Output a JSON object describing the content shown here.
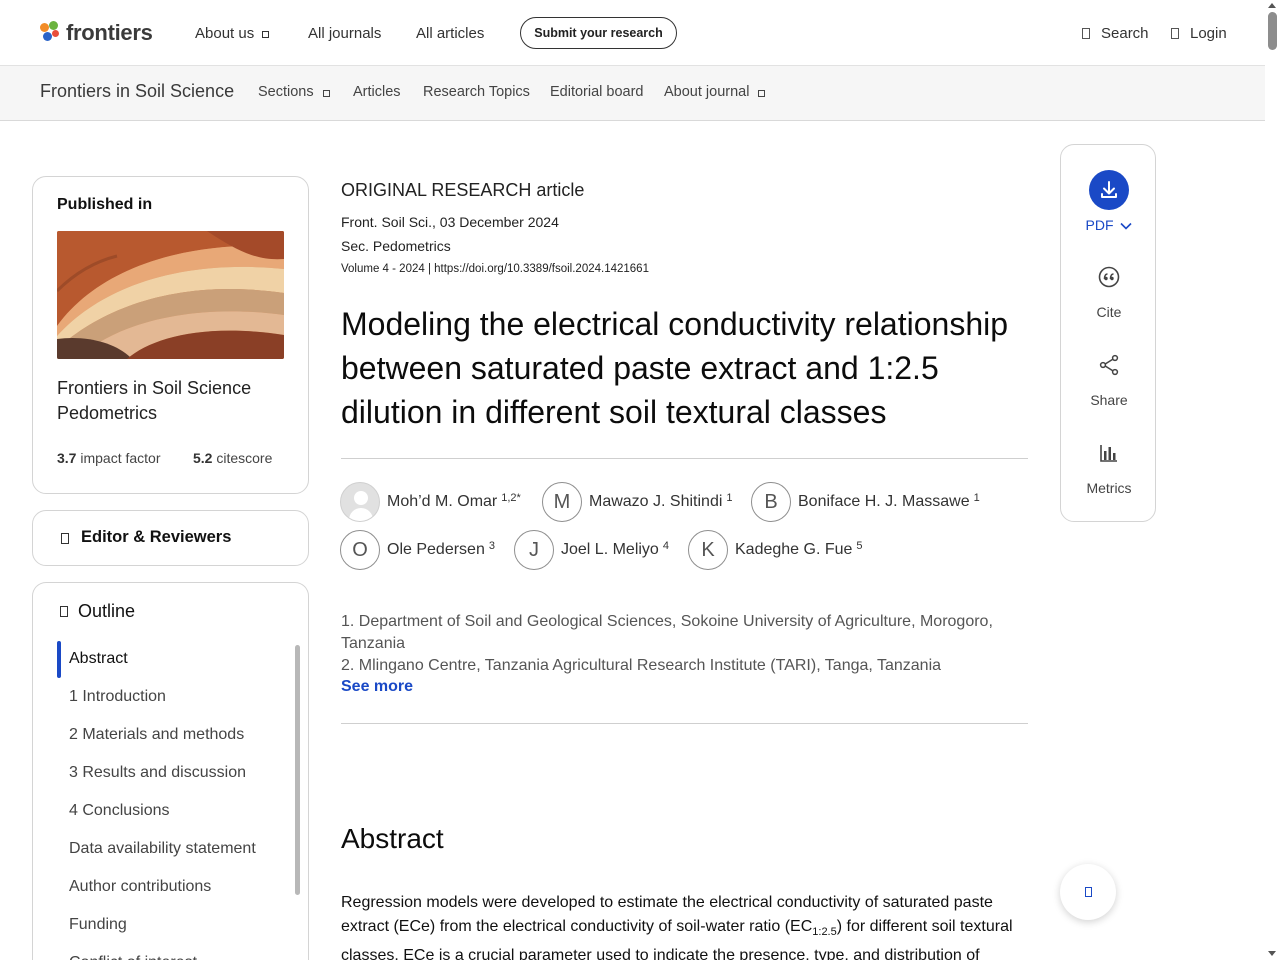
{
  "header": {
    "logo_text": "frontiers",
    "nav": [
      {
        "label": "About us",
        "has_dropdown": true
      },
      {
        "label": "All journals",
        "has_dropdown": false
      },
      {
        "label": "All articles",
        "has_dropdown": false
      }
    ],
    "submit_label": "Submit your research",
    "search_label": "Search",
    "login_label": "Login"
  },
  "journal_bar": {
    "title": "Frontiers in Soil Science",
    "nav": [
      {
        "label": "Sections",
        "has_dropdown": true
      },
      {
        "label": "Articles",
        "has_dropdown": false
      },
      {
        "label": "Research Topics",
        "has_dropdown": false
      },
      {
        "label": "Editorial board",
        "has_dropdown": false
      },
      {
        "label": "About journal",
        "has_dropdown": true
      }
    ]
  },
  "sidebar": {
    "published_in": {
      "heading": "Published in",
      "journal": "Frontiers in Soil Science",
      "section": "Pedometrics",
      "impact_factor_value": "3.7",
      "impact_factor_label": "impact factor",
      "citescore_value": "5.2",
      "citescore_label": "citescore"
    },
    "editor_label": "Editor & Reviewers",
    "outline": {
      "heading": "Outline",
      "items": [
        "Abstract",
        "1 Introduction",
        "2 Materials and methods",
        "3 Results and discussion",
        "4 Conclusions",
        "Data availability statement",
        "Author contributions",
        "Funding",
        "Conflict of interest"
      ],
      "active_index": 0
    }
  },
  "article": {
    "type": "ORIGINAL RESEARCH article",
    "citation": "Front. Soil Sci., 03 December 2024",
    "section": "Sec. Pedometrics",
    "volume": "Volume 4 - 2024 | ",
    "doi": "https://doi.org/10.3389/fsoil.2024.1421661",
    "title": "Modeling the electrical conductivity relationship between saturated paste extract and 1:2.5 dilution in different soil textural classes",
    "authors": [
      {
        "name": "Moh’d M. Omar",
        "aff": "1,2*",
        "initial": "",
        "photo": true
      },
      {
        "name": "Mawazo J. Shitindi",
        "aff": "1",
        "initial": "M"
      },
      {
        "name": "Boniface H. J. Massawe",
        "aff": "1",
        "initial": "B"
      },
      {
        "name": "Ole Pedersen",
        "aff": "3",
        "initial": "O"
      },
      {
        "name": "Joel L. Meliyo",
        "aff": "4",
        "initial": "J"
      },
      {
        "name": "Kadeghe G. Fue",
        "aff": "5",
        "initial": "K"
      }
    ],
    "affiliations": [
      "1. Department of Soil and Geological Sciences, Sokoine University of Agriculture, Morogoro, Tanzania",
      "2. Mlingano Centre, Tanzania Agricultural Research Institute (TARI), Tanga, Tanzania"
    ],
    "see_more": "See more",
    "abstract_heading": "Abstract",
    "abstract_part1": "Regression models were developed to estimate the electrical conductivity of saturated paste extract (ECe) from the electrical conductivity of soil-water ratio (EC",
    "abstract_sub": "1:2.5",
    "abstract_part2": ") for different soil textural classes. ECe is a crucial parameter used to indicate the presence, type, and distribution of"
  },
  "actions": {
    "pdf_label": "PDF",
    "cite_label": "Cite",
    "share_label": "Share",
    "metrics_label": "Metrics"
  },
  "colors": {
    "accent": "#1a49c6",
    "logo_green": "#6bb33f",
    "logo_orange": "#f28c28",
    "logo_blue": "#2b64c8"
  }
}
